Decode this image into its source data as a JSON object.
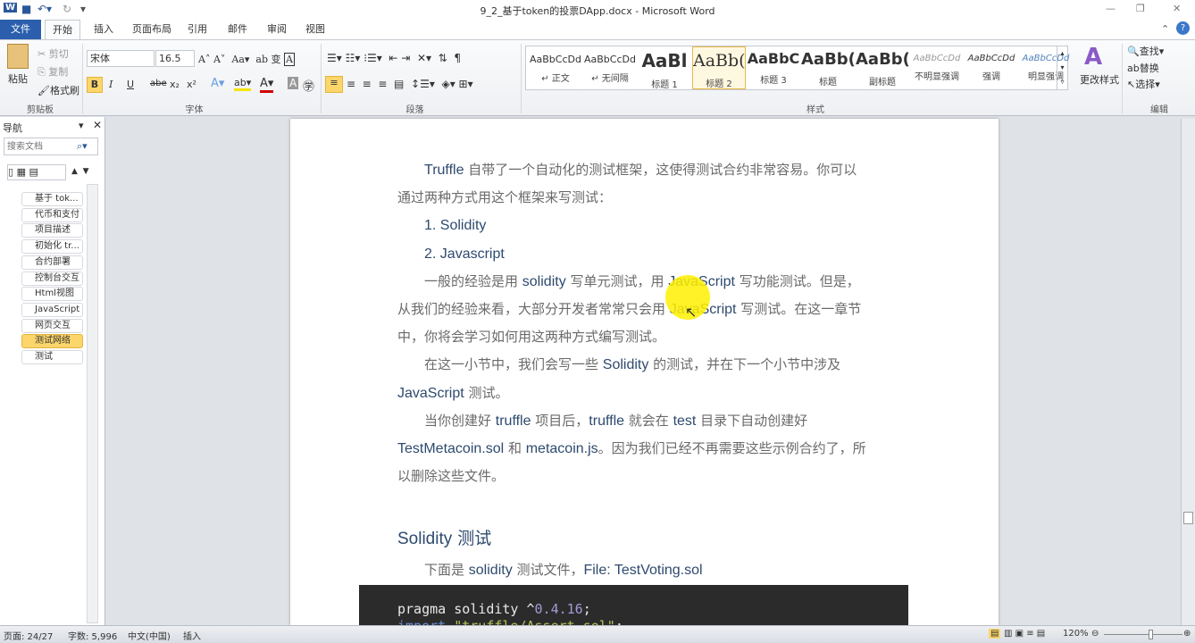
{
  "window": {
    "title": "9_2_基于token的投票DApp.docx - Microsoft Word",
    "app_icon": "W",
    "quick_access": [
      "save-icon",
      "undo-icon",
      "redo-icon",
      "customize-icon"
    ],
    "controls": [
      "—",
      "❐",
      "✕"
    ]
  },
  "tabs": [
    "文件",
    "开始",
    "插入",
    "页面布局",
    "引用",
    "邮件",
    "审阅",
    "视图"
  ],
  "ribbon": {
    "clipboard": {
      "paste": "粘贴",
      "cut": "剪切",
      "copy": "复制",
      "format_painter": "格式刷",
      "label": "剪贴板"
    },
    "font": {
      "name": "宋体",
      "size": "16.5",
      "label": "字体",
      "buttons": [
        "B",
        "I",
        "U",
        "abe",
        "x₂",
        "x²"
      ]
    },
    "paragraph": {
      "label": "段落"
    },
    "styles": {
      "items": [
        {
          "sample": "AaBbCcDd",
          "name": "↵ 正文"
        },
        {
          "sample": "AaBbCcDd",
          "name": "↵ 无间隔"
        },
        {
          "sample": "AaBl",
          "name": "标题 1"
        },
        {
          "sample": "AaBb(",
          "name": "标题 2"
        },
        {
          "sample": "AaBbC",
          "name": "标题 3"
        },
        {
          "sample": "AaBb(",
          "name": "标题"
        },
        {
          "sample": "AaBb(",
          "name": "副标题"
        },
        {
          "sample": "AaBbCcDd",
          "name": "不明显强调"
        },
        {
          "sample": "AaBbCcDd",
          "name": "强调"
        },
        {
          "sample": "AaBbCcDd",
          "name": "明显强调"
        }
      ],
      "selected": "标题 2",
      "change": "更改样式",
      "label": "样式"
    },
    "editing": {
      "find": "查找",
      "replace": "替换",
      "select": "选择",
      "label": "编辑"
    }
  },
  "nav": {
    "title": "导航",
    "search_placeholder": "搜索文档",
    "items": [
      "基于 tok...",
      "代币和支付",
      "项目描述",
      "初始化 tr...",
      "合约部署",
      "控制台交互",
      "Html视图",
      "JavaScript",
      "网页交互",
      "测试网络",
      "测试"
    ],
    "selected": "测试网络"
  },
  "document": {
    "lines": [
      [
        [
          "zh",
          "　　"
        ],
        [
          "en",
          "Truffle"
        ],
        [
          "zh",
          " 自带了一个自动化的测试框架，这使得测试合约非常容易。你可以"
        ]
      ],
      [
        [
          "zh",
          "通过两种方式用这个框架来写测试："
        ]
      ],
      [
        [
          "zh",
          "　　"
        ],
        [
          "en",
          "1. Solidity"
        ]
      ],
      [
        [
          "zh",
          "　　"
        ],
        [
          "en",
          "2. Javascript"
        ]
      ],
      [
        [
          "zh",
          "　　一般的经验是用 "
        ],
        [
          "en",
          "solidity"
        ],
        [
          "zh",
          " 写单元测试，用 "
        ],
        [
          "en",
          "JavaScript"
        ],
        [
          "zh",
          " 写功能测试。但是，"
        ]
      ],
      [
        [
          "zh",
          "从我们的经验来看，大部分开发者常常只会用 "
        ],
        [
          "en",
          "JavaScript"
        ],
        [
          "zh",
          " 写测试。在这一章节"
        ]
      ],
      [
        [
          "zh",
          "中，你将会学习如何用这两种方式编写测试。"
        ]
      ],
      [
        [
          "zh",
          "　　在这一小节中，我们会写一些 "
        ],
        [
          "en",
          "Solidity"
        ],
        [
          "zh",
          " 的测试，并在下一个小节中涉及"
        ]
      ],
      [
        [
          "en",
          "JavaScript"
        ],
        [
          "zh",
          " 测试。"
        ]
      ],
      [
        [
          "zh",
          "　　当你创建好 "
        ],
        [
          "en",
          "truffle"
        ],
        [
          "zh",
          " 项目后，"
        ],
        [
          "en",
          "truffle"
        ],
        [
          "zh",
          " 就会在 "
        ],
        [
          "en",
          "test"
        ],
        [
          "zh",
          " 目录下自动创建好"
        ]
      ],
      [
        [
          "en",
          "TestMetacoin.sol"
        ],
        [
          "zh",
          " 和 "
        ],
        [
          "en",
          "metacoin.js"
        ],
        [
          "zh",
          "。因为我们已经不再需要这些示例合约了，所"
        ]
      ],
      [
        [
          "zh",
          "以删除这些文件。"
        ]
      ]
    ],
    "heading": [
      [
        "en",
        "Solidity"
      ],
      [
        "zh",
        " 测试"
      ]
    ],
    "intro": [
      [
        "zh",
        "　　下面是 "
      ],
      [
        "en",
        "solidity"
      ],
      [
        "zh",
        " 测试文件，"
      ],
      [
        "en",
        "File: TestVoting.sol"
      ]
    ],
    "code": [
      [
        [
          "pragma solidity ^",
          "#e8e8e8"
        ],
        [
          "0.4.16",
          "#a59ad8"
        ],
        [
          ";",
          "#e8e8e8"
        ]
      ],
      [
        [
          "import ",
          "#6a8fd0"
        ],
        [
          "\"truffle/Assert.sol\"",
          "#b5c25a"
        ],
        [
          ";",
          "#e8e8e8"
        ]
      ]
    ]
  },
  "status": {
    "page": "页面: 24/27",
    "words": "字数: 5,996",
    "lang": "中文(中国)",
    "mode": "插入",
    "zoom": "120%"
  },
  "colors": {
    "file_tab": "#2b5fae",
    "nav_selected": "#fcd66b",
    "code_bg": "#2b2b2b",
    "cursor_highlight": "#fff000"
  }
}
